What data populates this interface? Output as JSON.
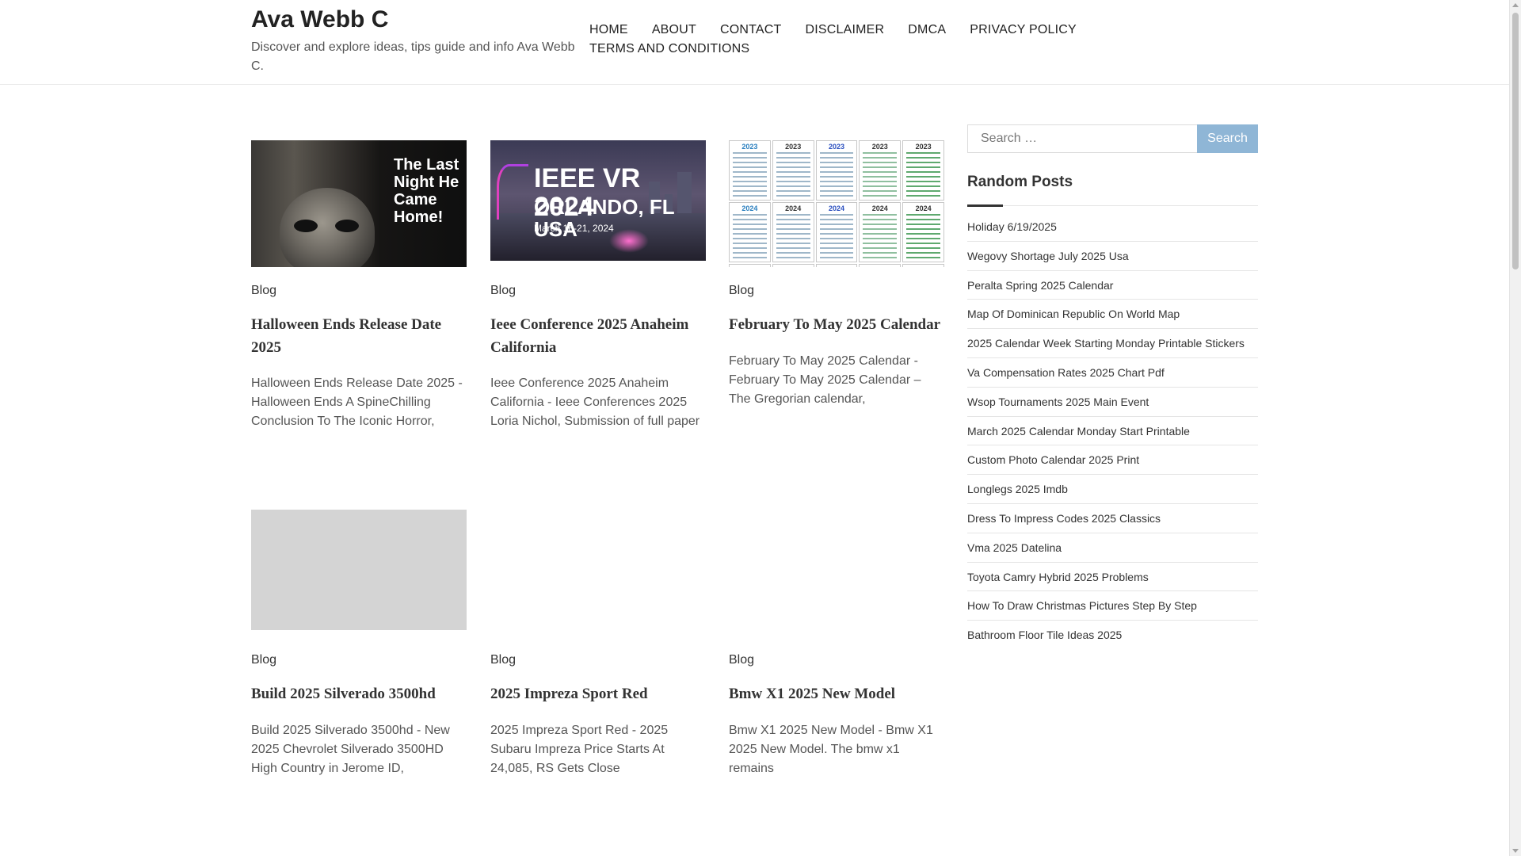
{
  "site": {
    "title": "Ava Webb C",
    "description": "Discover and explore ideas, tips guide and info Ava Webb C."
  },
  "nav": {
    "items": [
      "HOME",
      "ABOUT",
      "CONTACT",
      "DISCLAIMER",
      "DMCA",
      "PRIVACY POLICY",
      "TERMS AND CONDITIONS"
    ]
  },
  "posts": [
    {
      "category": "Blog",
      "title": "Halloween Ends Release Date 2025",
      "excerpt": "Halloween Ends Release Date 2025 - Halloween Ends A SpineChilling Conclusion To The Iconic Horror,",
      "image_text": "The Last Night He Came Home!"
    },
    {
      "category": "Blog",
      "title": "Ieee Conference 2025 Anaheim California",
      "excerpt": "Ieee Conference 2025 Anaheim California - Ieee Conferences 2025 Loria Nichol, Submission of full paper",
      "image_text": "IEEE VR 2024",
      "image_sub": "ORLANDO, FL USA",
      "image_date": "March 16-21, 2024"
    },
    {
      "category": "Blog",
      "title": "February To May 2025 Calendar",
      "excerpt": "February To May 2025 Calendar - February To May 2025 Calendar – The Gregorian calendar,",
      "cal_years": [
        "2023",
        "2023",
        "2023",
        "2023",
        "2023",
        "2024",
        "2024",
        "2024",
        "2024",
        "2024"
      ]
    },
    {
      "category": "Blog",
      "title": "Build 2025 Silverado 3500hd",
      "excerpt": "Build 2025 Silverado 3500hd - New 2025 Chevrolet Silverado 3500HD High Country in Jerome ID,"
    },
    {
      "category": "Blog",
      "title": "2025 Impreza Sport Red",
      "excerpt": "2025 Impreza Sport Red - 2025 Subaru Impreza Price Starts At 24,085, RS Gets Close"
    },
    {
      "category": "Blog",
      "title": "Bmw X1 2025 New Model",
      "excerpt": "Bmw X1 2025 New Model - Bmw X1 2025 New Model. The bmw x1 remains"
    }
  ],
  "sidebar": {
    "search": {
      "placeholder": "Search …",
      "button": "Search"
    },
    "random_title": "Random Posts",
    "random_posts": [
      "Holiday 6/19/2025",
      "Wegovy Shortage July 2025 Usa",
      "Peralta Spring 2025 Calendar",
      "Map Of Dominican Republic On World Map",
      "2025 Calendar Week Starting Monday Printable Stickers",
      "Va Compensation Rates 2025 Chart Pdf",
      "Wsop Tournaments 2025 Main Event",
      "March 2025 Calendar Monday Start Printable",
      "Custom Photo Calendar 2025 Print",
      "Longlegs 2025 Imdb",
      "Dress To Impress Codes 2025 Classics",
      "Vma 2025 Datelina",
      "Toyota Camry Hybrid 2025 Problems",
      "How To Draw Christmas Pictures Step By Step",
      "Bathroom Floor Tile Ideas 2025"
    ]
  },
  "colors": {
    "search_button": "#8fb6d6",
    "text": "#333333"
  }
}
